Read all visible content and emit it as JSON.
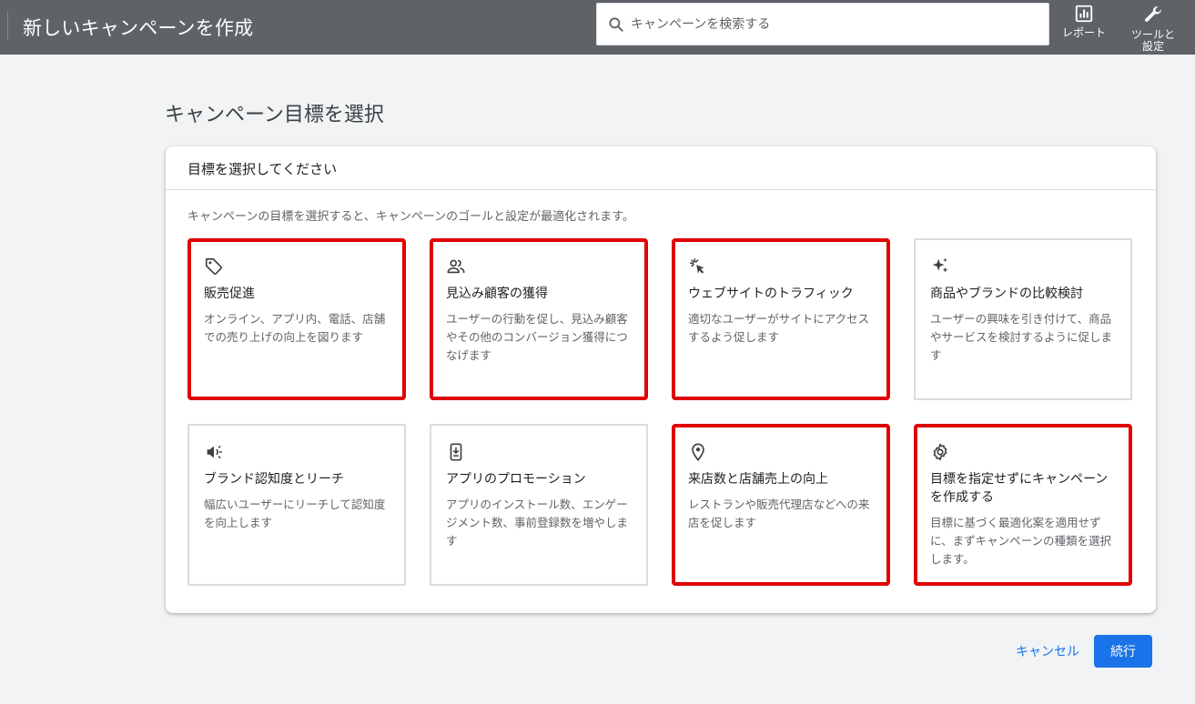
{
  "header": {
    "title": "新しいキャンペーンを作成",
    "search_placeholder": "キャンペーンを検索する",
    "report_label": "レポート",
    "tools_label_line1": "ツールと",
    "tools_label_line2": "設定"
  },
  "page": {
    "title": "キャンペーン目標を選択"
  },
  "card": {
    "header": "目標を選択してください",
    "subtitle": "キャンペーンの目標を選択すると、キャンペーンのゴールと設定が最適化されます。"
  },
  "goals": [
    {
      "title": "販売促進",
      "desc": "オンライン、アプリ内、電話、店舗での売り上げの向上を図ります",
      "icon": "tag-icon",
      "highlighted": true
    },
    {
      "title": "見込み顧客の獲得",
      "desc": "ユーザーの行動を促し、見込み顧客やその他のコンバージョン獲得につなげます",
      "icon": "people-icon",
      "highlighted": true
    },
    {
      "title": "ウェブサイトのトラフィック",
      "desc": "適切なユーザーがサイトにアクセスするよう促します",
      "icon": "click-cursor-icon",
      "highlighted": true
    },
    {
      "title": "商品やブランドの比較検討",
      "desc": "ユーザーの興味を引き付けて、商品やサービスを検討するように促します",
      "icon": "sparkle-icon",
      "highlighted": false
    },
    {
      "title": "ブランド認知度とリーチ",
      "desc": "幅広いユーザーにリーチして認知度を向上します",
      "icon": "megaphone-icon",
      "highlighted": false
    },
    {
      "title": "アプリのプロモーション",
      "desc": "アプリのインストール数、エンゲージメント数、事前登録数を増やします",
      "icon": "phone-download-icon",
      "highlighted": false
    },
    {
      "title": "来店数と店舗売上の向上",
      "desc": "レストランや販売代理店などへの来店を促します",
      "icon": "location-pin-icon",
      "highlighted": true
    },
    {
      "title": "目標を指定せずにキャンペーンを作成する",
      "desc": "目標に基づく最適化案を適用せずに、まずキャンペーンの種類を選択します。",
      "icon": "gear-icon",
      "highlighted": true
    }
  ],
  "footer": {
    "cancel_label": "キャンセル",
    "next_label": "続行"
  },
  "colors": {
    "topbar": "#5f6368",
    "accent": "#1a73e8",
    "highlight_border": "#e00000"
  }
}
